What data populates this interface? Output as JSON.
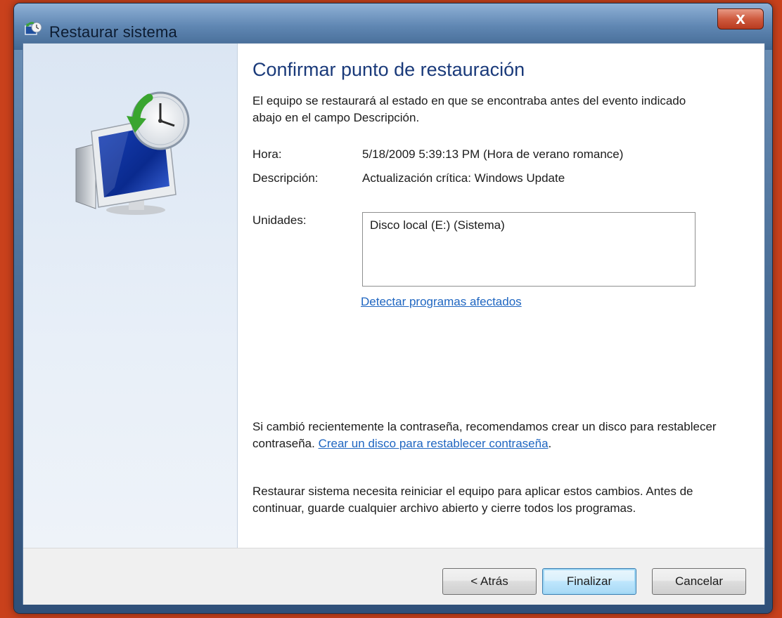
{
  "window": {
    "title": "Restaurar sistema",
    "close_label": "x"
  },
  "main": {
    "heading": "Confirmar punto de restauración",
    "intro": "El equipo se restaurará al estado en que se encontraba antes del evento indicado abajo en el campo Descripción.",
    "time_label": "Hora:",
    "time_value": "5/18/2009 5:39:13 PM  (Hora de verano romance)",
    "description_label": "Descripción:",
    "description_value": "Actualización crítica: Windows Update",
    "drives_label": "Unidades:",
    "drives": [
      "Disco local (E:) (Sistema)"
    ],
    "detect_link": "Detectar programas afectados",
    "password_text": "Si cambió recientemente la contraseña, recomendamos crear un disco para restablecer contraseña.",
    "password_link": "Crear un disco para restablecer contraseña",
    "password_end": ".",
    "restart_text": "Restaurar sistema necesita reiniciar el equipo para aplicar estos cambios. Antes de continuar, guarde cualquier archivo abierto y cierre todos los programas."
  },
  "buttons": {
    "back": "< Atrás",
    "finish": "Finalizar",
    "cancel": "Cancelar"
  },
  "icons": {
    "title": "system-restore-icon",
    "art": "computer-clock-restore-icon"
  },
  "colors": {
    "background": "#c9411c",
    "heading": "#1a3a7a",
    "link": "#1f66c1"
  }
}
